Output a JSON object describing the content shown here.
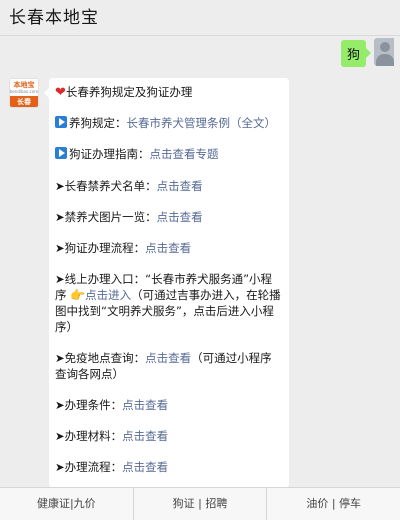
{
  "header": {
    "title": "长春本地宝"
  },
  "sent_message": {
    "text": "狗"
  },
  "bot_avatar": {
    "logo_line1": "本地宝",
    "logo_line2": "bendibao.com",
    "city": "长春"
  },
  "message": {
    "intro": "长春养狗规定及狗证办理",
    "rules_label": "养狗规定：",
    "rules_link": "长春市养犬管理条例（全文）",
    "guide_label": "狗证办理指南：",
    "guide_link": "点击查看专题",
    "banned_label": "➤长春禁养犬名单：",
    "banned_link": "点击查看",
    "pics_label": "➤禁养犬图片一览：",
    "pics_link": "点击查看",
    "process_label": "➤狗证办理流程：",
    "process_link": "点击查看",
    "online_label": "➤线上办理入口：“长春市养犬服务通”小程序",
    "online_link": "点击进入",
    "online_note": "（可通过吉事办进入，在轮播图中找到“文明养犬服务”，点击后进入小程序）",
    "vaccine_label": "➤免疫地点查询：",
    "vaccine_link": "点击查看",
    "vaccine_note": "（可通过小程序查询各网点）",
    "cond_label": "➤办理条件：",
    "cond_link": "点击查看",
    "mat_label": "➤办理材料：",
    "mat_link": "点击查看",
    "flow_label": "➤办理流程：",
    "flow_link": "点击查看"
  },
  "footer": {
    "items": [
      "健康证|九价",
      "狗证 | 招聘",
      "油价 | 停车"
    ]
  }
}
